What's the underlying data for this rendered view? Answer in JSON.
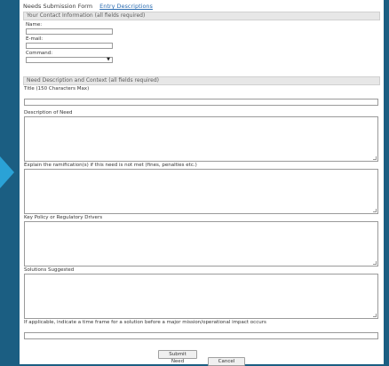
{
  "form": {
    "title": "Needs Submission Form",
    "link": "Entry Descriptions"
  },
  "contact": {
    "heading": "Your Contact Information (all fields required)",
    "name_label": "Name:",
    "email_label": "E-mail:",
    "command_label": "Command:"
  },
  "need": {
    "heading": "Need Description and Context (all fields required)",
    "title_label": "Title (150 Characters Max)",
    "description_label": "Description of Need",
    "ramification_label": "Explain the ramification(s) if this need is not met (fines, penalties etc.)",
    "drivers_label": "Key Policy or Regulatory Drivers",
    "solutions_label": "Solutions Suggested",
    "timeframe_label": "If applicable, indicate a time frame for a solution before a major mission/operational impact occurs"
  },
  "buttons": {
    "submit": "Submit Need",
    "cancel": "Cancel"
  },
  "colors": {
    "background": "#1b5e82",
    "arrow": "#2aa2d6",
    "link": "#2a6bb0",
    "section_header": "#e7e7e7"
  }
}
